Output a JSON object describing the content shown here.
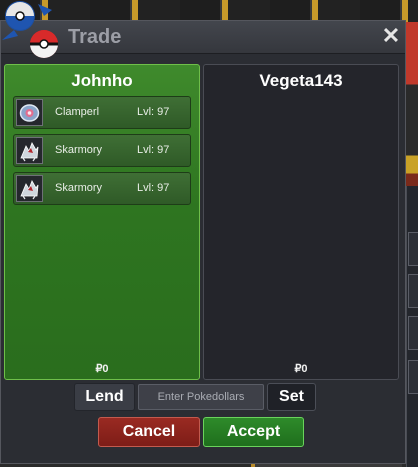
{
  "window": {
    "title": "Trade",
    "close_glyph": "✕"
  },
  "left_panel": {
    "player": "Johnho",
    "money": "₽0",
    "color": "#2e7520",
    "pokemon": [
      {
        "name": "Clamperl",
        "level": "Lvl: 97",
        "icon": "clamperl-icon"
      },
      {
        "name": "Skarmory",
        "level": "Lvl: 97",
        "icon": "skarmory-icon"
      },
      {
        "name": "Skarmory",
        "level": "Lvl: 97",
        "icon": "skarmory-icon"
      }
    ]
  },
  "right_panel": {
    "player": "Vegeta143",
    "money": "₽0",
    "color": "#24252b"
  },
  "controls": {
    "lend_label": "Lend",
    "money_placeholder": "Enter Pokedollars",
    "money_value": "",
    "set_label": "Set",
    "cancel_label": "Cancel",
    "accept_label": "Accept",
    "cancel_color": "#8a241d",
    "accept_color": "#278024"
  }
}
